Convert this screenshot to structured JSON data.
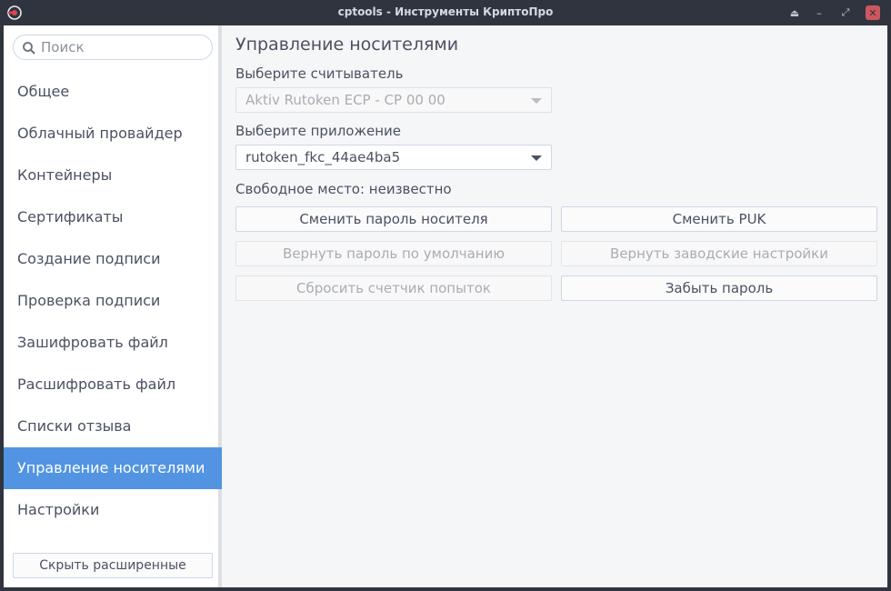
{
  "window": {
    "title": "cptools - Инструменты КриптоПро"
  },
  "sidebar": {
    "search_placeholder": "Поиск",
    "items": [
      {
        "label": "Общее"
      },
      {
        "label": "Облачный провайдер"
      },
      {
        "label": "Контейнеры"
      },
      {
        "label": "Сертификаты"
      },
      {
        "label": "Создание подписи"
      },
      {
        "label": "Проверка подписи"
      },
      {
        "label": "Зашифровать файл"
      },
      {
        "label": "Расшифровать файл"
      },
      {
        "label": "Списки отзыва"
      },
      {
        "label": "Управление носителями"
      },
      {
        "label": "Настройки"
      }
    ],
    "active_index": 9,
    "hide_button_label": "Скрыть расширенные"
  },
  "main": {
    "title": "Управление носителями",
    "reader_label": "Выберите считыватель",
    "reader_value": "Aktiv Rutoken ECP - CP 00 00",
    "app_label": "Выберите приложение",
    "app_value": "rutoken_fkc_44ae4ba5",
    "free_space": "Свободное место: неизвестно",
    "buttons": {
      "change_pin": "Сменить пароль носителя",
      "change_puk": "Сменить PUK",
      "reset_default_pin": "Вернуть пароль по умолчанию",
      "factory_reset": "Вернуть заводские настройки",
      "reset_counter": "Сбросить счетчик попыток",
      "forget_pin": "Забыть пароль"
    }
  },
  "colors": {
    "accent": "#5294e2",
    "titlebar": "#2f343f",
    "close": "#cc575d"
  }
}
